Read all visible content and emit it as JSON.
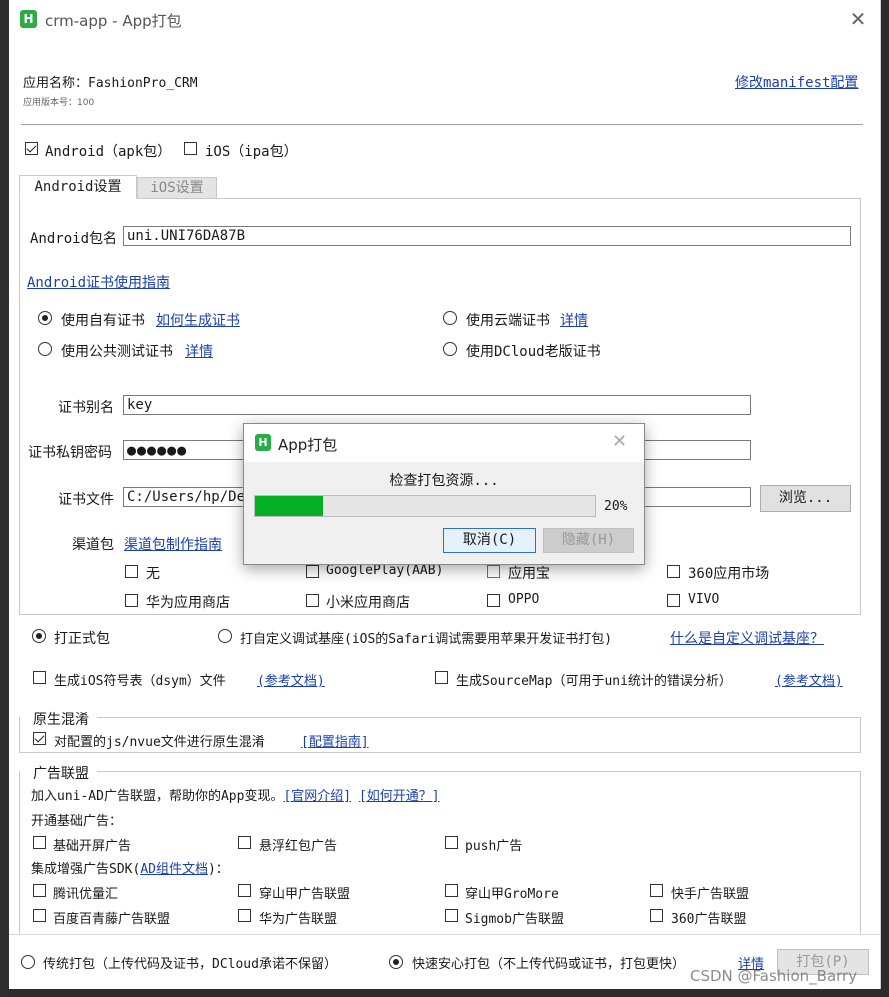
{
  "window": {
    "title": "crm-app - App打包",
    "logo": "H"
  },
  "app_info": {
    "name_label": "应用名称：FashionPro_CRM",
    "version_label": "应用版本号：100",
    "manifest_link": "修改manifest配置"
  },
  "platforms": {
    "android": {
      "label": "Android（apk包）",
      "checked": true
    },
    "ios": {
      "label": "iOS（ipa包）",
      "checked": false
    }
  },
  "tabs": [
    {
      "label": "Android设置",
      "active": true
    },
    {
      "label": "iOS设置",
      "active": false
    }
  ],
  "android": {
    "package_label": "Android包名",
    "package_value": "uni.UNI76DA87B",
    "cert_guide_link": "Android证书使用指南",
    "cert_options": {
      "own": {
        "label": "使用自有证书",
        "link": "如何生成证书",
        "checked": true
      },
      "cloud": {
        "label": "使用云端证书",
        "link": "详情",
        "checked": false
      },
      "public": {
        "label": "使用公共测试证书",
        "link": "详情",
        "checked": false
      },
      "dcloud": {
        "label": "使用DCloud老版证书",
        "checked": false
      }
    },
    "alias_label": "证书别名",
    "alias_value": "key",
    "password_label": "证书私钥密码",
    "password_value": "●●●●●●",
    "file_label": "证书文件",
    "file_value": "C:/Users/hp/Des",
    "browse_label": "浏览...",
    "channel_label": "渠道包",
    "channel_link": "渠道包制作指南",
    "channels": [
      {
        "label": "无",
        "checked": false
      },
      {
        "label": "GooglePlay(AAB)",
        "checked": false
      },
      {
        "label": "应用宝",
        "checked": false
      },
      {
        "label": "360应用市场",
        "checked": false
      },
      {
        "label": "华为应用商店",
        "checked": false
      },
      {
        "label": "小米应用商店",
        "checked": false
      },
      {
        "label": "OPPO",
        "checked": false
      },
      {
        "label": "VIVO",
        "checked": false
      }
    ]
  },
  "build_type": {
    "formal": {
      "label": "打正式包",
      "checked": true
    },
    "custom": {
      "label": "打自定义调试基座(iOS的Safari调试需要用苹果开发证书打包)",
      "checked": false
    },
    "custom_link": "什么是自定义调试基座？"
  },
  "extras": {
    "dsym": {
      "label": "生成iOS符号表（dsym）文件",
      "link": "(参考文档)",
      "checked": false
    },
    "sourcemap": {
      "label": "生成SourceMap（可用于uni统计的错误分析）",
      "link": "(参考文档)",
      "checked": false
    }
  },
  "obfuscation": {
    "title": "原生混淆",
    "label": "对配置的js/nvue文件进行原生混淆",
    "link": "[配置指南]",
    "checked": true
  },
  "ads": {
    "title": "广告联盟",
    "intro": "加入uni-AD广告联盟，帮助你的App变现。",
    "intro_link1": "[官网介绍]",
    "intro_link2": "[如何开通？]",
    "basic_title": "开通基础广告：",
    "basic": [
      {
        "label": "基础开屏广告"
      },
      {
        "label": "悬浮红包广告"
      },
      {
        "label": "push广告"
      }
    ],
    "sdk_title_prefix": "集成增强广告SDK(",
    "sdk_link": "AD组件文档",
    "sdk_title_suffix": ")：",
    "sdk": [
      {
        "label": "腾讯优量汇"
      },
      {
        "label": "穿山甲广告联盟"
      },
      {
        "label": "穿山甲GroMore"
      },
      {
        "label": "快手广告联盟"
      },
      {
        "label": "百度百青藤广告联盟"
      },
      {
        "label": "华为广告联盟"
      },
      {
        "label": "Sigmob广告联盟"
      },
      {
        "label": "360广告联盟"
      }
    ]
  },
  "footer": {
    "traditional": {
      "label": "传统打包（上传代码及证书，DCloud承诺不保留）",
      "checked": false
    },
    "safe": {
      "label": "快速安心打包（不上传代码或证书，打包更快）",
      "checked": true
    },
    "details_link": "详情",
    "build_button": "打包(P)"
  },
  "dialog": {
    "title": "App打包",
    "status": "检查打包资源...",
    "progress": 20,
    "progress_text": "20%",
    "cancel": "取消(C)",
    "hide": "隐藏(H)"
  },
  "watermark": "CSDN @Fashion_Barry",
  "colors": {
    "progress": "#06b025",
    "link": "#1a3fb0",
    "brand": "#2aac47"
  }
}
